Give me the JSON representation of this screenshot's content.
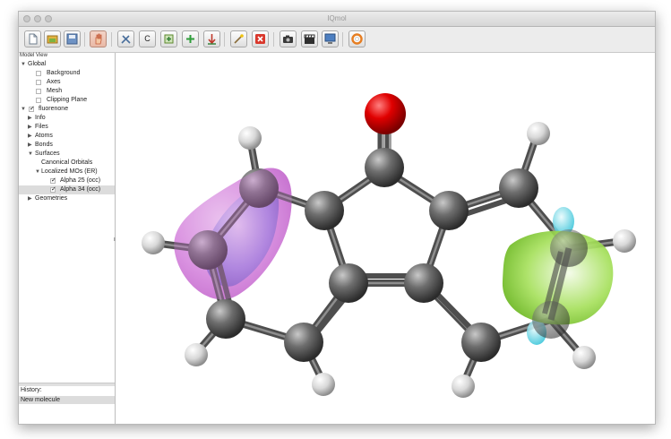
{
  "window": {
    "title": "IQmol"
  },
  "toolbar": {
    "buttons": [
      {
        "name": "new-file-button",
        "icon": "new-file-icon",
        "label": ""
      },
      {
        "name": "open-file-button",
        "icon": "open-folder-icon",
        "label": ""
      },
      {
        "name": "save-button",
        "icon": "save-disk-icon",
        "label": ""
      },
      {
        "name": "select-mode-button",
        "icon": "hand-select-icon",
        "label": ""
      },
      {
        "name": "build-tools-button",
        "icon": "tools-icon",
        "label": ""
      },
      {
        "name": "element-c-button",
        "icon": "",
        "label": "C"
      },
      {
        "name": "add-hydrogens-button",
        "icon": "add-hydrogens-icon",
        "label": ""
      },
      {
        "name": "add-fragment-button",
        "icon": "add-fragment-icon",
        "label": ""
      },
      {
        "name": "minimize-button",
        "icon": "minimize-energy-icon",
        "label": ""
      },
      {
        "name": "selection-wand-button",
        "icon": "magic-wand-icon",
        "label": ""
      },
      {
        "name": "delete-button",
        "icon": "delete-x-icon",
        "label": ""
      },
      {
        "name": "screenshot-button",
        "icon": "camera-icon",
        "label": ""
      },
      {
        "name": "record-animation-button",
        "icon": "clapperboard-icon",
        "label": ""
      },
      {
        "name": "server-button",
        "icon": "monitor-icon",
        "label": ""
      },
      {
        "name": "help-button",
        "icon": "lifebuoy-icon",
        "label": ""
      }
    ]
  },
  "model_view": {
    "title": "Model View",
    "global": "Global",
    "background": "Background",
    "axes": "Axes",
    "mesh": "Mesh",
    "clipping_plane": "Clipping Plane",
    "molecule": "fluorenone",
    "info": "Info",
    "files": "Files",
    "atoms": "Atoms",
    "bonds": "Bonds",
    "surfaces": "Surfaces",
    "canonical_orbitals": "Canonical Orbitals",
    "localized_mos": "Localized MOs (ER)",
    "alpha25": "Alpha 25 (occ)",
    "alpha34": "Alpha 34 (occ)",
    "geometries": "Geometries"
  },
  "history": {
    "title": "History:",
    "items": [
      "New molecule"
    ]
  },
  "colors": {
    "carbon": "#5a5a5a",
    "hydrogen": "#e8e8e8",
    "oxygen": "#e00000",
    "orbital_a_pos": "#c56ad0",
    "orbital_a_neg": "#4a4fbf",
    "orbital_b_pos": "#7ed321",
    "orbital_b_neg": "#5fd8e8"
  }
}
